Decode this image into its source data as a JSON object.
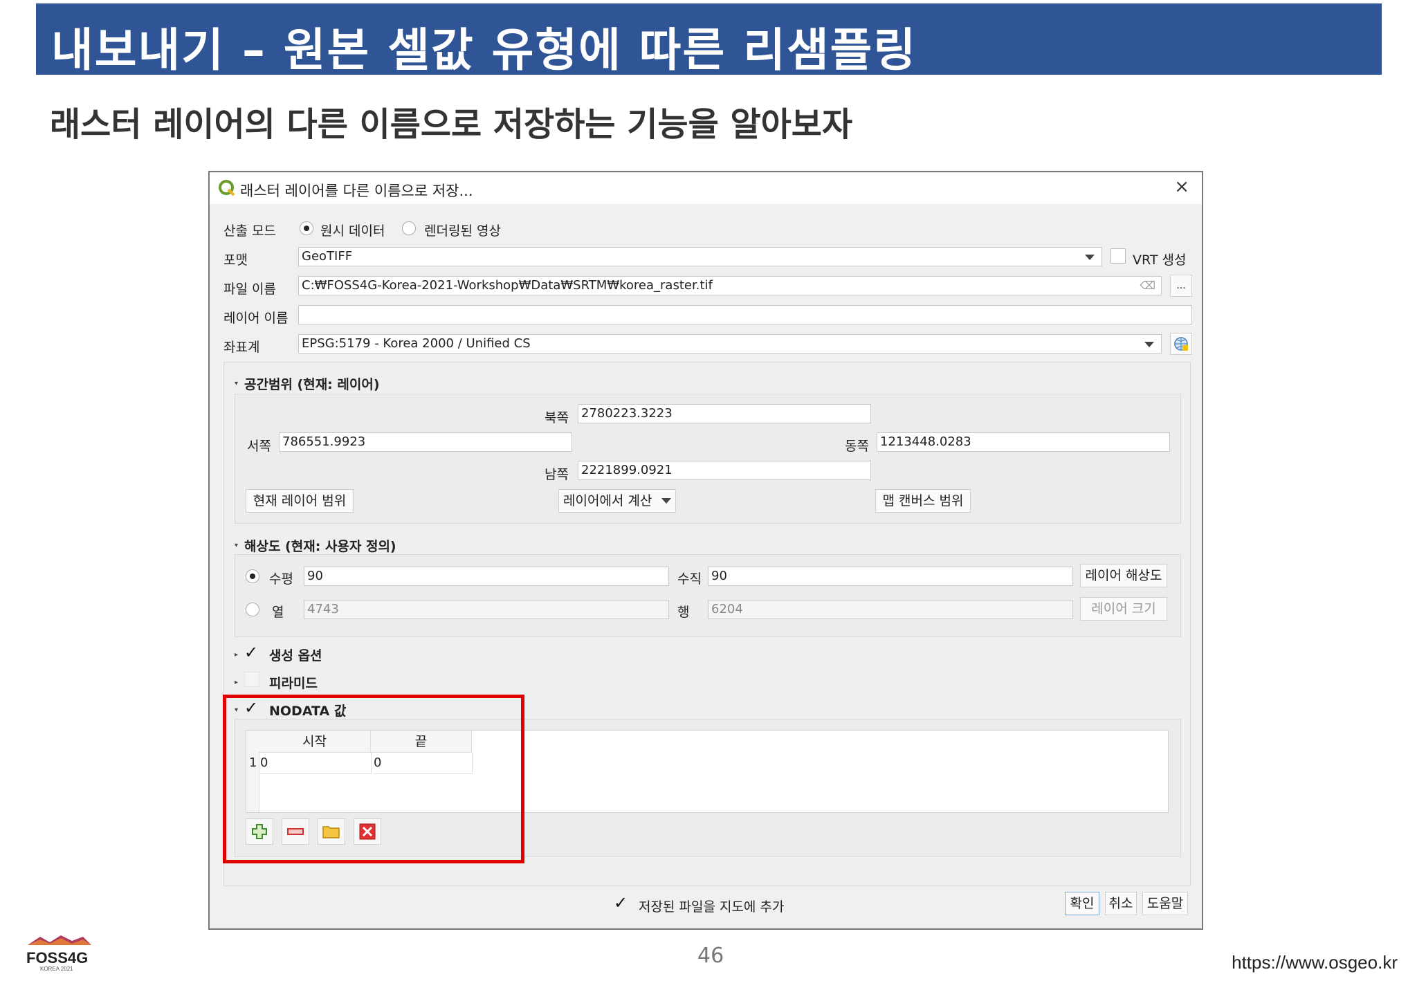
{
  "slide": {
    "title": "내보내기 – 원본 셀값 유형에 따른 리샘플링",
    "subtitle": "래스터 레이어의 다른 이름으로 저장하는 기능을 알아보자",
    "page_number": "46",
    "footer_url": "https://www.osgeo.kr",
    "logo_text": "FOSS4G",
    "logo_subtext": "KOREA 2021"
  },
  "dialog": {
    "title": "래스터 레이어를 다른 이름으로 저장...",
    "close_symbol": "×",
    "output_mode": {
      "label": "산출 모드",
      "options": [
        "원시 데이터",
        "렌더링된 영상"
      ],
      "selected": "원시 데이터"
    },
    "format": {
      "label": "포맷",
      "value": "GeoTIFF",
      "vrt_label": "VRT 생성"
    },
    "filename": {
      "label": "파일 이름",
      "value": "C:₩FOSS4G-Korea-2021-Workshop₩Data₩SRTM₩korea_raster.tif",
      "browse_label": "..."
    },
    "layer_name": {
      "label": "레이어 이름",
      "value": ""
    },
    "crs": {
      "label": "좌표계",
      "value": "EPSG:5179 - Korea 2000 / Unified CS"
    },
    "extent": {
      "title": "공간범위 (현재: 레이어)",
      "north_label": "북쪽",
      "north": "2780223.3223",
      "west_label": "서쪽",
      "west": "786551.9923",
      "east_label": "동쪽",
      "east": "1213448.0283",
      "south_label": "남쪽",
      "south": "2221899.0921",
      "btn_current": "현재 레이어 범위",
      "btn_calc": "레이어에서 계산",
      "btn_canvas": "맵 캔버스 범위"
    },
    "resolution": {
      "title": "해상도 (현재: 사용자 정의)",
      "horizontal_label": "수평",
      "horizontal": "90",
      "vertical_label": "수직",
      "vertical": "90",
      "btn_layer_res": "레이어 해상도",
      "columns_label": "열",
      "columns": "4743",
      "rows_label": "행",
      "rows": "6204",
      "btn_layer_size": "레이어 크기"
    },
    "create_options": {
      "label": "생성 옵션"
    },
    "pyramids": {
      "label": "피라미드"
    },
    "nodata": {
      "label": "NODATA 값",
      "col_start": "시작",
      "col_end": "끝",
      "rows": [
        {
          "index": "1",
          "start": "0",
          "end": "0"
        }
      ]
    },
    "add_to_map": "저장된 파일을 지도에 추가",
    "ok": "확인",
    "cancel": "취소",
    "help": "도움말",
    "check_symbol": "✓"
  }
}
